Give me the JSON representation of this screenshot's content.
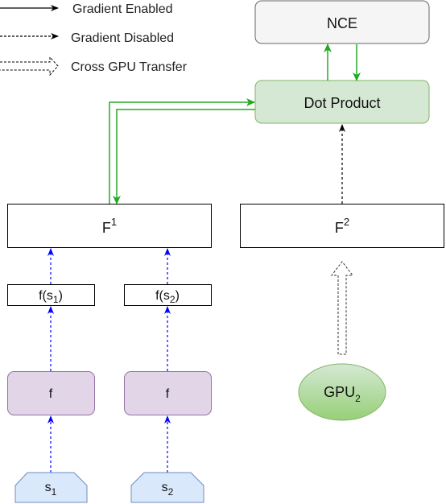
{
  "legend": {
    "items": [
      {
        "label": "Gradient Enabled",
        "style": "solid-arrow"
      },
      {
        "label": "Gradient Disabled",
        "style": "dotted-arrow"
      },
      {
        "label": "Cross GPU Transfer",
        "style": "hollow-dotted-arrow"
      }
    ]
  },
  "nodes": {
    "nce": {
      "label": "NCE",
      "fill": "#f5f5f5",
      "stroke": "#666666"
    },
    "dot_product": {
      "label": "Dot Product",
      "fill": "#d5e8d4",
      "stroke": "#82b366"
    },
    "F1": {
      "base": "F",
      "sup": "1"
    },
    "F2": {
      "base": "F",
      "sup": "2"
    },
    "fs1": {
      "prefix": "f(s",
      "sub": "1",
      "suffix": ")"
    },
    "fs2": {
      "prefix": "f(s",
      "sub": "2",
      "suffix": ")"
    },
    "f1": {
      "label": "f",
      "fill": "#e1d5e7",
      "stroke": "#9673a6"
    },
    "f2": {
      "label": "f",
      "fill": "#e1d5e7",
      "stroke": "#9673a6"
    },
    "s1": {
      "base": "s",
      "sub": "1",
      "fill": "#dae8fc",
      "stroke": "#6c8ebf"
    },
    "s2": {
      "base": "s",
      "sub": "2",
      "fill": "#dae8fc",
      "stroke": "#6c8ebf"
    },
    "gpu2": {
      "base": "GPU",
      "sub": "2",
      "fill": "#97d077",
      "stroke": "#82b366"
    }
  },
  "colors": {
    "gradient_enabled": "#22aa22",
    "gradient_disabled_local": "#0000ff",
    "gradient_disabled": "#000000"
  }
}
